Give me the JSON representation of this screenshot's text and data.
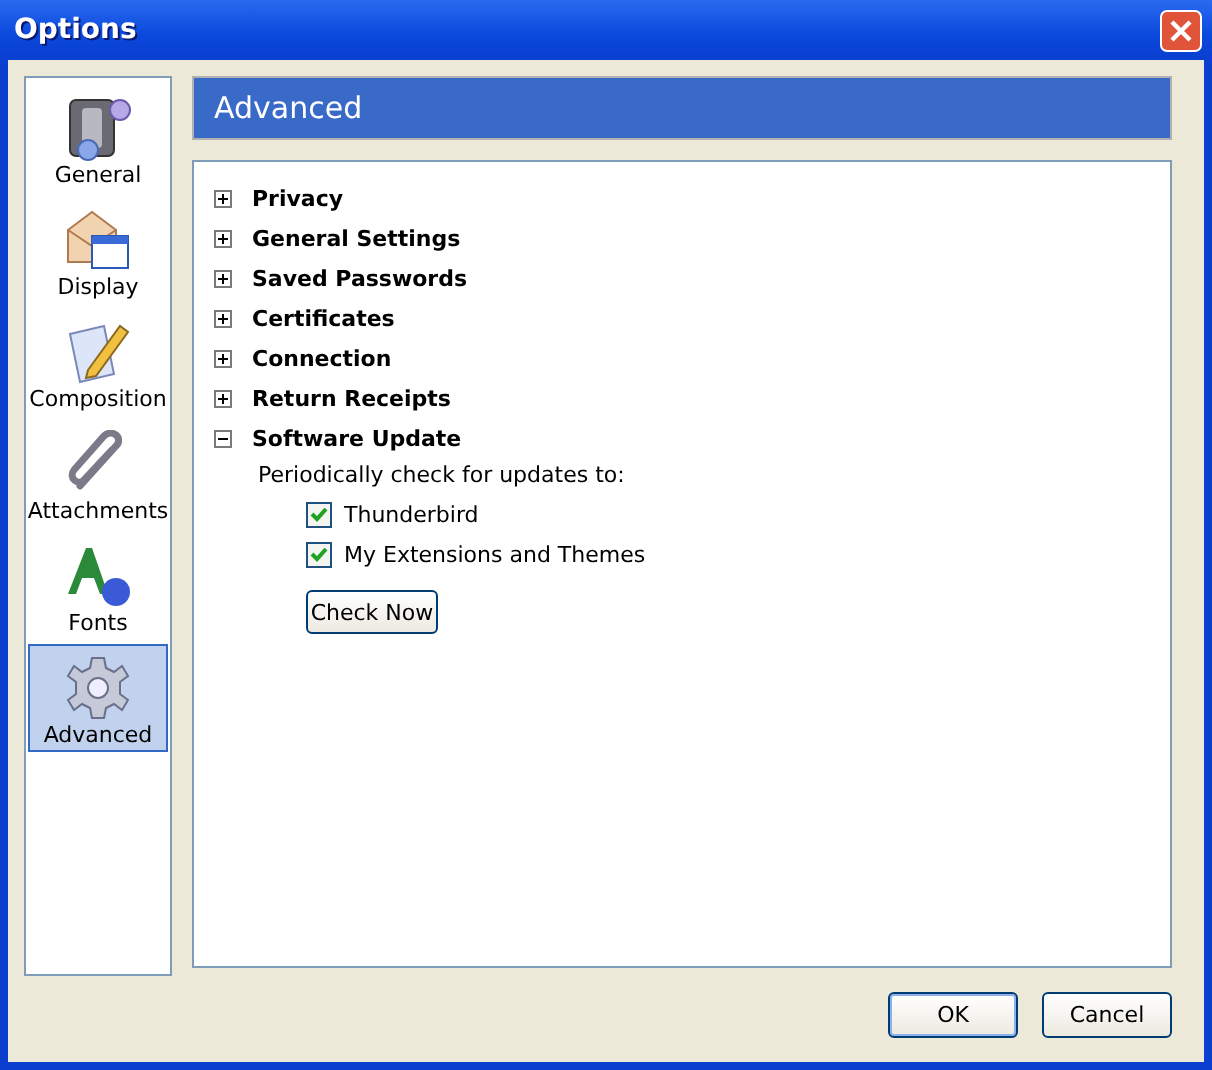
{
  "window": {
    "title": "Options"
  },
  "sidebar": {
    "items": [
      {
        "label": "General",
        "kind": "general",
        "selected": false
      },
      {
        "label": "Display",
        "kind": "display",
        "selected": false
      },
      {
        "label": "Composition",
        "kind": "composition",
        "selected": false
      },
      {
        "label": "Attachments",
        "kind": "attachments",
        "selected": false
      },
      {
        "label": "Fonts",
        "kind": "fonts",
        "selected": false
      },
      {
        "label": "Advanced",
        "kind": "advanced",
        "selected": true
      }
    ]
  },
  "header": "Advanced",
  "sections": [
    {
      "label": "Privacy",
      "expanded": false
    },
    {
      "label": "General Settings",
      "expanded": false
    },
    {
      "label": "Saved Passwords",
      "expanded": false
    },
    {
      "label": "Certificates",
      "expanded": false
    },
    {
      "label": "Connection",
      "expanded": false
    },
    {
      "label": "Return Receipts",
      "expanded": false
    },
    {
      "label": "Software Update",
      "expanded": true,
      "description": "Periodically check for updates to:",
      "options": [
        {
          "label": "Thunderbird",
          "checked": true
        },
        {
          "label": "My Extensions and Themes",
          "checked": true
        }
      ],
      "button": "Check Now"
    }
  ],
  "buttons": [
    "OK",
    "Cancel"
  ]
}
